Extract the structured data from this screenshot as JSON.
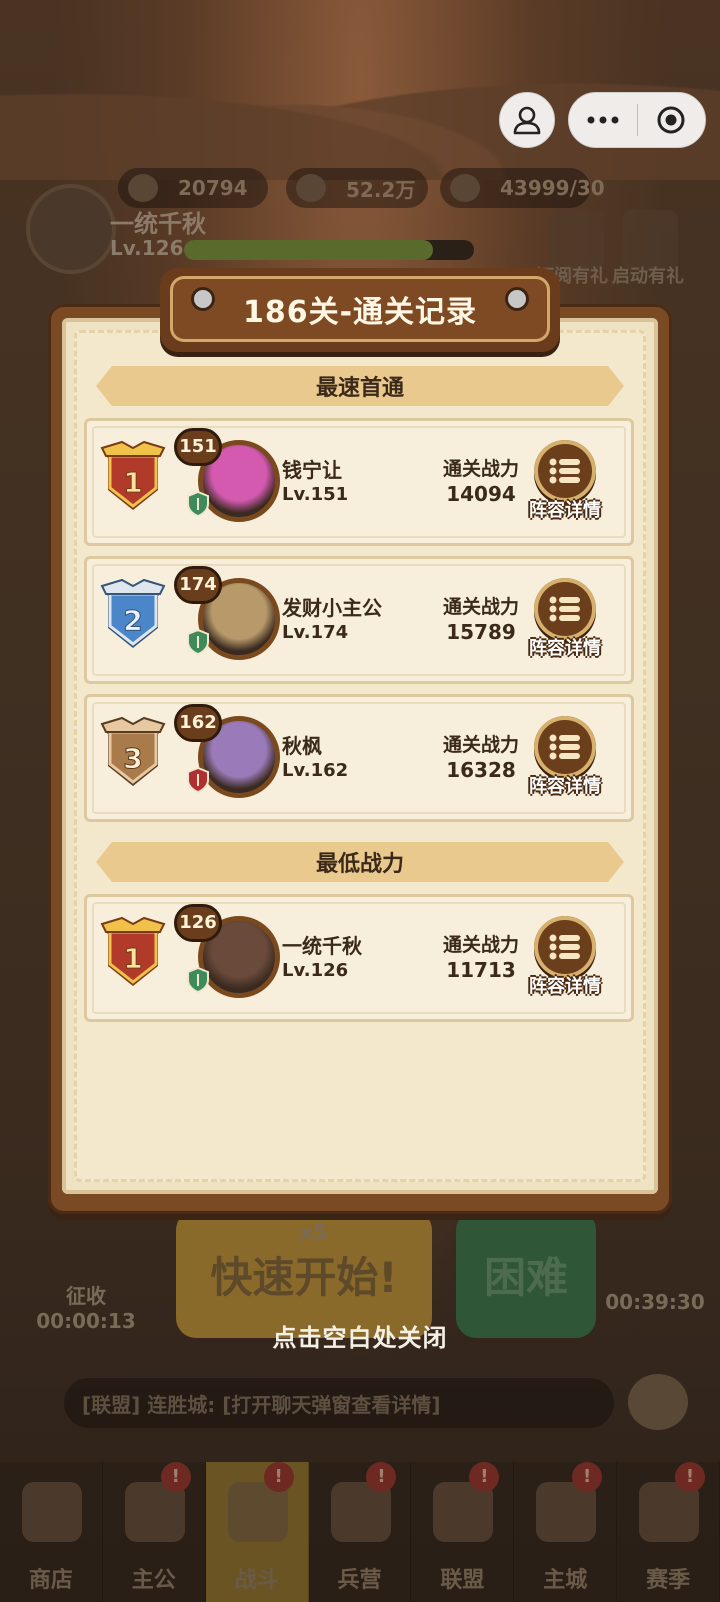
{
  "background": {
    "resources": [
      "20794",
      "52.2万",
      "43999/30"
    ],
    "player": {
      "name": "一统千秋",
      "level": "Lv.126",
      "exp_fraction": 0.86
    },
    "side_labels": [
      "订阅有礼",
      "启动有礼"
    ],
    "start_button": "快速开始!",
    "start_cost": "x5",
    "hard_button": "困难",
    "left_timer": {
      "label": "征收",
      "time": "00:00:13"
    },
    "right_timer": "00:39:30",
    "chat_text": "[联盟] 连胜城: [打开聊天弹窗查看详情]",
    "nav": [
      "商店",
      "主公",
      "战斗",
      "兵营",
      "联盟",
      "主城",
      "赛季"
    ],
    "nav_active_index": 2,
    "nav_badge": "!"
  },
  "close_hint": "点击空白处关闭",
  "dialog": {
    "title": "186关-通关记录",
    "power_label": "通关战力",
    "detail_label": "阵容详情",
    "sections": [
      {
        "title": "最速首通",
        "rows": [
          {
            "rank": "1",
            "rank_color": "gold",
            "level_bubble": "151",
            "name": "钱宁让",
            "level": "Lv.151",
            "power": "14094",
            "shield_color": "#3e8a5a",
            "avatar_color": "#d45ab0"
          },
          {
            "rank": "2",
            "rank_color": "silver",
            "level_bubble": "174",
            "name": "发财小主公",
            "level": "Lv.174",
            "power": "15789",
            "shield_color": "#3e8a5a",
            "avatar_color": "#b89a6a"
          },
          {
            "rank": "3",
            "rank_color": "bronze",
            "level_bubble": "162",
            "name": "秋枫",
            "level": "Lv.162",
            "power": "16328",
            "shield_color": "#b03030",
            "avatar_color": "#9a7ab8"
          }
        ]
      },
      {
        "title": "最低战力",
        "rows": [
          {
            "rank": "1",
            "rank_color": "gold",
            "level_bubble": "126",
            "name": "一统千秋",
            "level": "Lv.126",
            "power": "11713",
            "shield_color": "#3e8a5a",
            "avatar_color": "#6a4a3a"
          }
        ]
      }
    ]
  }
}
